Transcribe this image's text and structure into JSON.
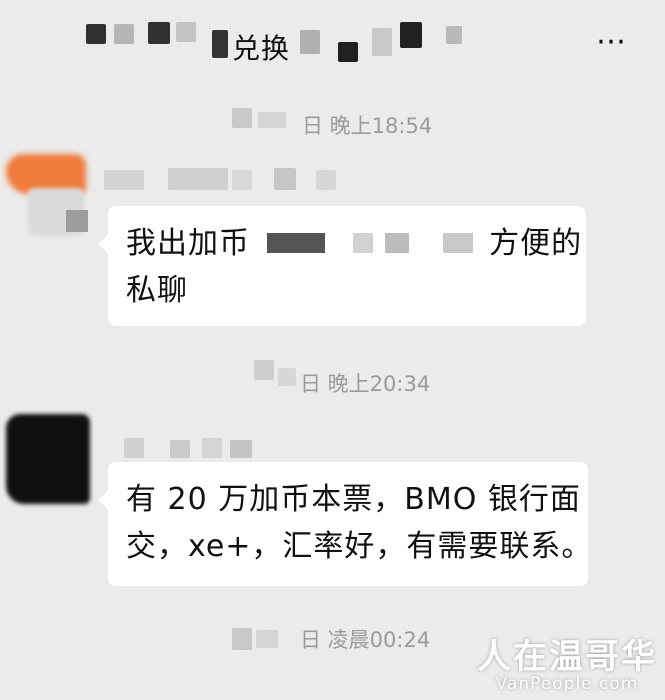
{
  "header": {
    "title": "兑换",
    "more_icon": "⋯"
  },
  "messages": [
    {
      "time": "日 晚上18:54",
      "text_before": "我出加币",
      "text_after": "方便的",
      "text_line2": "私聊"
    },
    {
      "time": "日 晚上20:34",
      "line1": "有 20 万加币本票，BMO 银行面",
      "line2": "交，xe+，汇率好，有需要联系。"
    },
    {
      "time": "日 凌晨00:24"
    }
  ],
  "watermark": {
    "name": "人在温哥华",
    "url": "VanPeople.com"
  },
  "colors": {
    "background": "#ebebeb",
    "bubble": "#ffffff",
    "timestamp": "#9a9a9a"
  }
}
